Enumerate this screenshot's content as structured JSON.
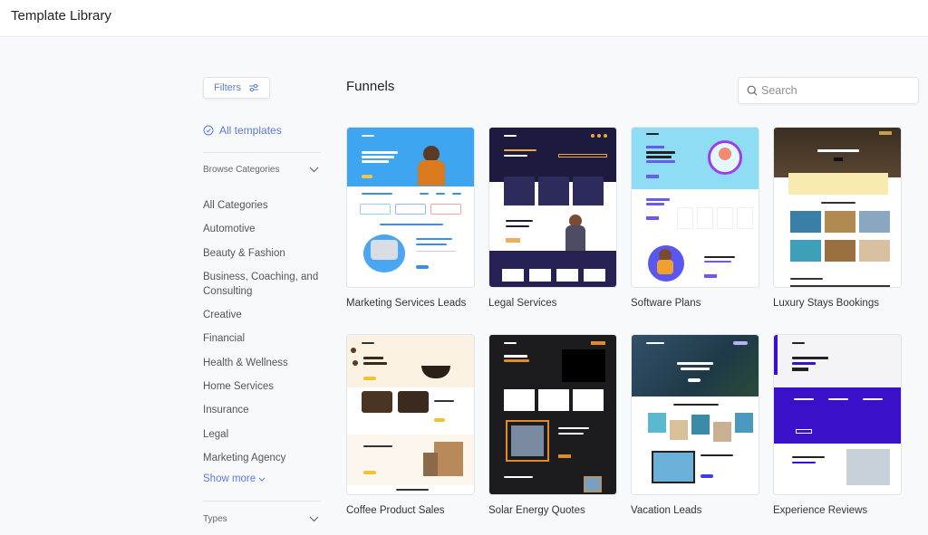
{
  "header": {
    "title": "Template Library"
  },
  "sidebar": {
    "filters_label": "Filters",
    "all_templates_label": "All templates",
    "browse_categories_label": "Browse Categories",
    "categories": [
      "All Categories",
      "Automotive",
      "Beauty & Fashion",
      "Business, Coaching, and Consulting",
      "Creative",
      "Financial",
      "Health & Wellness",
      "Home Services",
      "Insurance",
      "Legal",
      "Marketing Agency"
    ],
    "show_more_label": "Show more",
    "types_label": "Types"
  },
  "main": {
    "title": "Funnels",
    "search": {
      "placeholder": "Search",
      "value": ""
    },
    "templates": [
      {
        "label": "Marketing Services Leads",
        "theme": "blue-marketing"
      },
      {
        "label": "Legal Services",
        "theme": "navy-legal"
      },
      {
        "label": "Software Plans",
        "theme": "cyan-software"
      },
      {
        "label": "Luxury Stays Bookings",
        "theme": "brown-luxury"
      },
      {
        "label": "Coffee Product Sales",
        "theme": "cream-coffee"
      },
      {
        "label": "Solar Energy Quotes",
        "theme": "dark-solar"
      },
      {
        "label": "Vacation Leads",
        "theme": "ocean-vacation"
      },
      {
        "label": "Experience Reviews",
        "theme": "purple-reviews"
      }
    ]
  },
  "colors": {
    "accent": "#5b7bd5",
    "background": "#f8f9fb",
    "border": "#e3e6eb"
  }
}
